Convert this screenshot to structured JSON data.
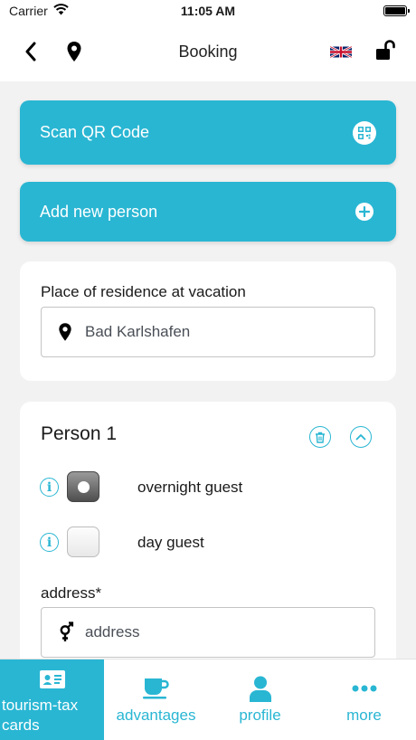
{
  "status_bar": {
    "carrier": "Carrier",
    "time": "11:05 AM"
  },
  "nav": {
    "title": "Booking"
  },
  "actions": {
    "scan_label": "Scan QR Code",
    "add_person_label": "Add new person"
  },
  "residence": {
    "label": "Place of residence at vacation",
    "value": "Bad Karlshafen"
  },
  "person": {
    "title": "Person 1",
    "options": [
      {
        "label": "overnight guest",
        "selected": true
      },
      {
        "label": "day guest",
        "selected": false
      }
    ],
    "address_label": "address*",
    "address_placeholder": "address"
  },
  "tabs": [
    {
      "label": "tourism-tax\ncards",
      "icon": "id-card-icon",
      "active": true
    },
    {
      "label": "advantages",
      "icon": "coffee-cup-icon",
      "active": false
    },
    {
      "label": "profile",
      "icon": "user-icon",
      "active": false
    },
    {
      "label": "more",
      "icon": "ellipsis-icon",
      "active": false
    }
  ],
  "colors": {
    "accent": "#29b6d3",
    "background": "#f2f2f2"
  }
}
